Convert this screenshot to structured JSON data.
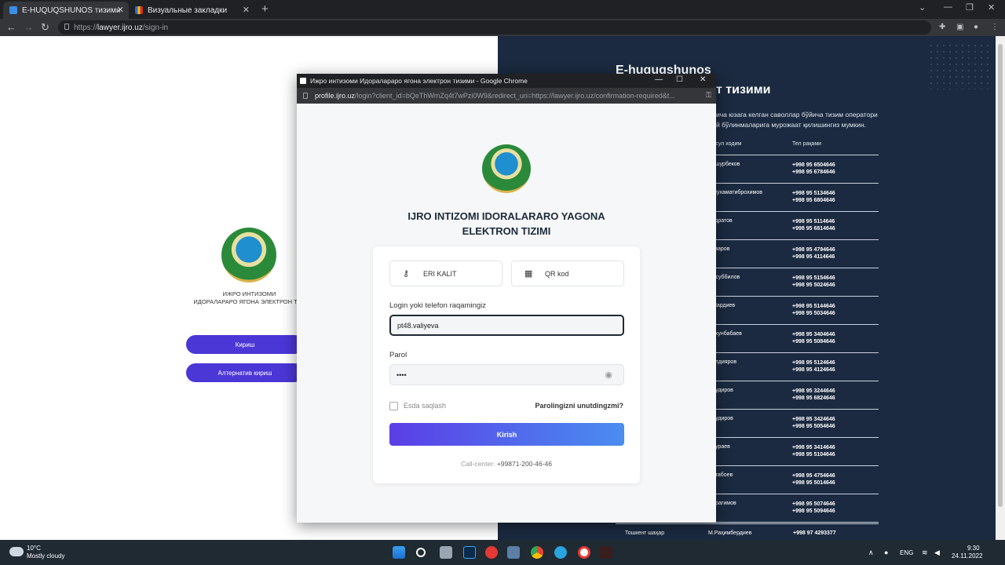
{
  "browser": {
    "tabs": [
      {
        "label": "E-HUQUQSHUNOS тизими",
        "active": true
      },
      {
        "label": "Визуальные закладки",
        "active": false
      }
    ],
    "url_prefix": "https://",
    "url_host": "lawyer.ijro.uz",
    "url_path": "/sign-in"
  },
  "left": {
    "org_line1": "ИЖРО ИНТИЗОМИ",
    "org_line2": "ИДОРАЛАРАРО ЯГОНА ЭЛЕКТРОН ТИЗ",
    "login_button": "Кириш",
    "alt_login_button": "Алтернатив кириш"
  },
  "right": {
    "title_line1": "E-huquqshunos",
    "title_line2": "т тизими",
    "note": "ича юзага келган саволлар бўйича тизим оператори й бўлинмаларига мурожаат қилишингиз мумкин.",
    "col_person": "ъсул ходим",
    "col_phone": "Тел рақами",
    "rows": [
      {
        "name": "ашурбеков",
        "phones": [
          "+998 95 6504646",
          "+998 95 6784646"
        ]
      },
      {
        "name": "Мухаматиброхимов",
        "phones": [
          "+998 95 5134646",
          "+998 95 6804646"
        ]
      },
      {
        "name": "удратов",
        "phones": [
          "+998 95 5114646",
          "+998 95 6814646"
        ]
      },
      {
        "name": "азаров",
        "phones": [
          "+998 95 4794646",
          "+998 95 4114646"
        ]
      },
      {
        "name": "Ўсуббилов",
        "phones": [
          "+998 95 5154646",
          "+998 95 5024646"
        ]
      },
      {
        "name": "Мардиев",
        "phones": [
          "+998 95 5144646",
          "+998 95 5034646"
        ]
      },
      {
        "name": "ахунбабаев",
        "phones": [
          "+998 95 3404646",
          "+998 95 5084646"
        ]
      },
      {
        "name": "елдияров",
        "phones": [
          "+998 95 5124646",
          "+998 95 4124646"
        ]
      },
      {
        "name": "Кудиров",
        "phones": [
          "+998 95 3244646",
          "+998 95 6824646"
        ]
      },
      {
        "name": "Кудиров",
        "phones": [
          "+998 95 3424646",
          "+998 95 5054646"
        ]
      },
      {
        "name": "Кураев",
        "phones": [
          "+998 95 3414646",
          "+998 95 5104646"
        ]
      },
      {
        "name": "атабоев",
        "phones": [
          "+998 95 4754646",
          "+998 95 5014646"
        ]
      },
      {
        "name": "брагимов",
        "phones": [
          "+998 95 5074646",
          "+998 95 5094646"
        ]
      }
    ],
    "last_region": "Тошкент шаҳар",
    "last_name": "М.Раҳимбердиев",
    "last_phone": "+998 97 4293377"
  },
  "popup": {
    "window_title": "Ижро интизоми Идоралараро ягона электрон тизими - Google Chrome",
    "url_host": "profile.ijro.uz",
    "url_rest": "/login?client_id=bQeThWmZq4t7wPzi0W9&redirect_uri=https://lawyer.ijro.uz/confirmation-required&t...",
    "heading_line1": "IJRO INTIZOMI IDORALARARO YAGONA",
    "heading_line2": "ELEKTRON TIZIMI",
    "eri_button": "ERI KALIT",
    "qr_button": "QR kod",
    "login_label": "Login yoki telefon raqamingiz",
    "login_value": "pt48.valiyeva",
    "password_label": "Parol",
    "password_value": "••••",
    "remember_label": "Esda saqlash",
    "forgot_link": "Parolingizni unutdingzmi?",
    "submit_button": "Kirish",
    "call_center_label": "Call-center:",
    "call_center_phone": "+99871-200-46-46"
  },
  "taskbar": {
    "weather_temp": "10°C",
    "weather_text": "Mostly cloudy",
    "lang": "ENG",
    "time": "9:30",
    "date": "24.11.2022"
  },
  "colors": {
    "accent": "#4b36d6",
    "right_bg": "#1b2a40",
    "popup_bg": "#f6f7f8"
  }
}
